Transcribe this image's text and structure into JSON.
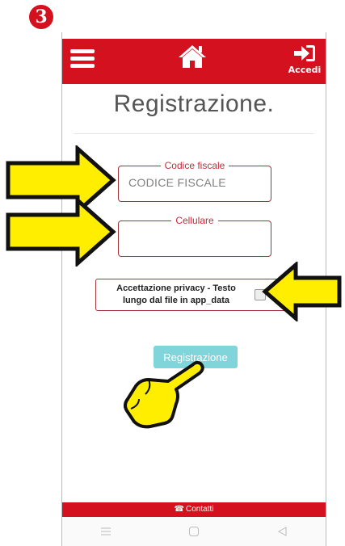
{
  "step_badge": "3",
  "header": {
    "login_label": "Accedi",
    "icons": [
      "menu-icon",
      "home-icon",
      "sign-in-icon"
    ]
  },
  "page_title": "Registrazione.",
  "form": {
    "fiscal_code": {
      "legend": "Codice fiscale",
      "placeholder": "CODICE FISCALE",
      "value": ""
    },
    "cellphone": {
      "legend": "Cellulare",
      "placeholder": "",
      "value": ""
    },
    "privacy": {
      "text": "Accettazione privacy - Testo lungo dal file in app_data",
      "checked": false
    },
    "submit_label": "Registrazione"
  },
  "footer": {
    "contact_label": "Contatti"
  },
  "colors": {
    "brand_red": "#d4111f",
    "button_teal": "#7fd5da",
    "field_border": "#a3323a",
    "arrow_yellow": "#ffee00"
  }
}
